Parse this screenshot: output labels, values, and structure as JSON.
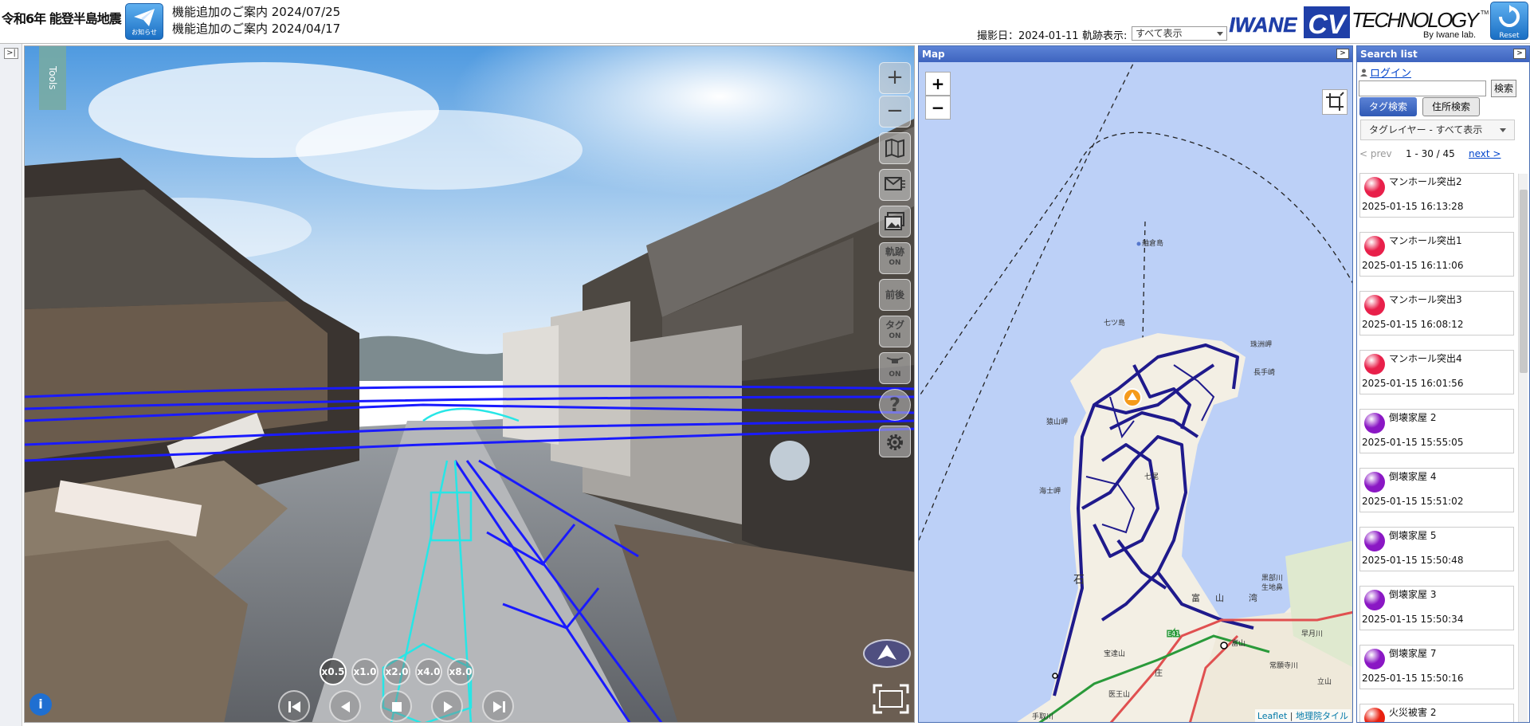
{
  "header": {
    "site_title": "令和6年 能登半島地震",
    "notice_label": "お知らせ",
    "news": [
      "機能追加のご案内 2024/07/25",
      "機能追加のご案内 2024/04/17"
    ],
    "shot_date": "撮影日：2024-01-11",
    "track_label": "軌跡表示:",
    "track_select_value": "すべて表示",
    "logo_iwane": "IWANE",
    "logo_cv": "CV",
    "logo_technology": "TECHNOLOGY",
    "logo_tm": "TM",
    "logo_by": "By Iwane lab.",
    "reset_label": "Reset"
  },
  "pano": {
    "tools_label": "Tools",
    "side_buttons": {
      "track": [
        "軌跡",
        "ON"
      ],
      "front_back": "前後",
      "tag": [
        "タグ",
        "ON"
      ],
      "drone_on": "ON",
      "help": "?"
    },
    "speeds": [
      "x0.5",
      "x1.0",
      "x2.0",
      "x4.0",
      "x8.0"
    ],
    "info": "i"
  },
  "map": {
    "title": "Map",
    "zoom_in": "+",
    "zoom_out": "−",
    "labels": [
      "舳倉島",
      "七ツ島",
      "珠洲岬",
      "長手崎",
      "猿山岬",
      "七尾",
      "海士岬",
      "石",
      "富",
      "山",
      "湾",
      "黒部川",
      "生地鼻",
      "富山",
      "庄",
      "宝達山",
      "医王山",
      "手取川",
      "早月川",
      "常願寺川",
      "立山",
      "E41"
    ],
    "attribution_leaflet": "Leaflet",
    "attribution_sep": " | ",
    "attribution_tile": "地理院タイル"
  },
  "search": {
    "title": "Search list",
    "login": "ログイン",
    "search_input_value": "",
    "search_button": "検索",
    "tag_search": "タグ検索",
    "address_search": "住所検索",
    "tag_layer": "タグレイヤー - すべて表示",
    "prev": "< prev",
    "range": "1 - 30 / 45",
    "next": "next >",
    "results": [
      {
        "name": "マンホール突出2",
        "time": "2025-01-15 16:13:28",
        "color": "#e8204a"
      },
      {
        "name": "マンホール突出1",
        "time": "2025-01-15 16:11:06",
        "color": "#e8204a"
      },
      {
        "name": "マンホール突出3",
        "time": "2025-01-15 16:08:12",
        "color": "#e8204a"
      },
      {
        "name": "マンホール突出4",
        "time": "2025-01-15 16:01:56",
        "color": "#e8204a"
      },
      {
        "name": "倒壊家屋 2",
        "time": "2025-01-15 15:55:05",
        "color": "#8a17c4"
      },
      {
        "name": "倒壊家屋 4",
        "time": "2025-01-15 15:51:02",
        "color": "#8a17c4"
      },
      {
        "name": "倒壊家屋 5",
        "time": "2025-01-15 15:50:48",
        "color": "#8a17c4"
      },
      {
        "name": "倒壊家屋 3",
        "time": "2025-01-15 15:50:34",
        "color": "#8a17c4"
      },
      {
        "name": "倒壊家屋 7",
        "time": "2025-01-15 15:50:16",
        "color": "#8a17c4"
      },
      {
        "name": "火災被害 2",
        "time": "",
        "color": "#e82010"
      }
    ]
  }
}
